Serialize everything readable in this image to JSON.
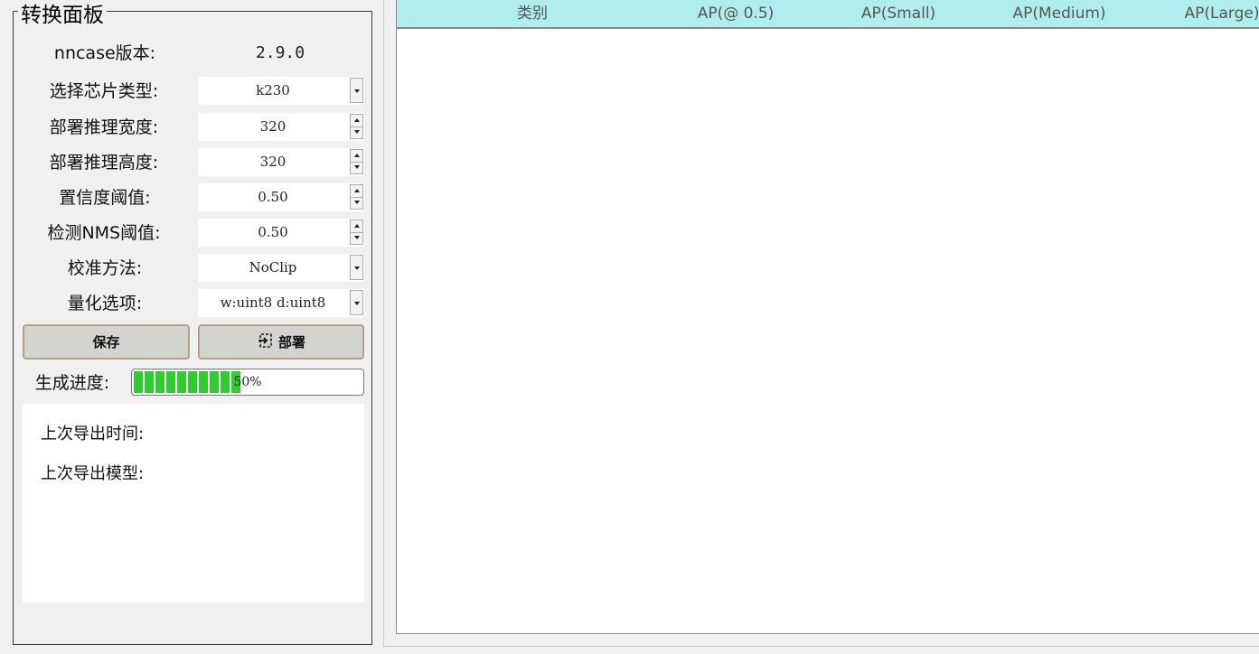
{
  "panel": {
    "title": "转换面板",
    "version_label": "nncase版本:",
    "version_value": "2.9.0",
    "fields": [
      {
        "label": "选择芯片类型:",
        "value": "k230",
        "control": "combo"
      },
      {
        "label": "部署推理宽度:",
        "value": "320",
        "control": "spin"
      },
      {
        "label": "部署推理高度:",
        "value": "320",
        "control": "spin"
      },
      {
        "label": "置信度阈值:",
        "value": "0.50",
        "control": "spin"
      },
      {
        "label": "检测NMS阈值:",
        "value": "0.50",
        "control": "spin"
      },
      {
        "label": "校准方法:",
        "value": "NoClip",
        "control": "combo"
      },
      {
        "label": "量化选项:",
        "value": "w:uint8 d:uint8",
        "control": "combo"
      }
    ],
    "save_label": "保存",
    "deploy_label": "部署",
    "progress_label": "生成进度:",
    "progress_value": 0.5,
    "progress_text": "50%",
    "info": {
      "last_export_time_label": "上次导出时间:",
      "last_export_model_label": "上次导出模型:"
    }
  },
  "table": {
    "columns": [
      "类别",
      "AP(@ 0.5)",
      "AP(Small)",
      "AP(Medium)",
      "AP(Large)"
    ],
    "rows": []
  },
  "colors": {
    "header_bg": "#b0eeee",
    "progress_fill": "#2ecc2e",
    "button_bg": "#d2d4d0",
    "button_border": "#b79f84"
  }
}
